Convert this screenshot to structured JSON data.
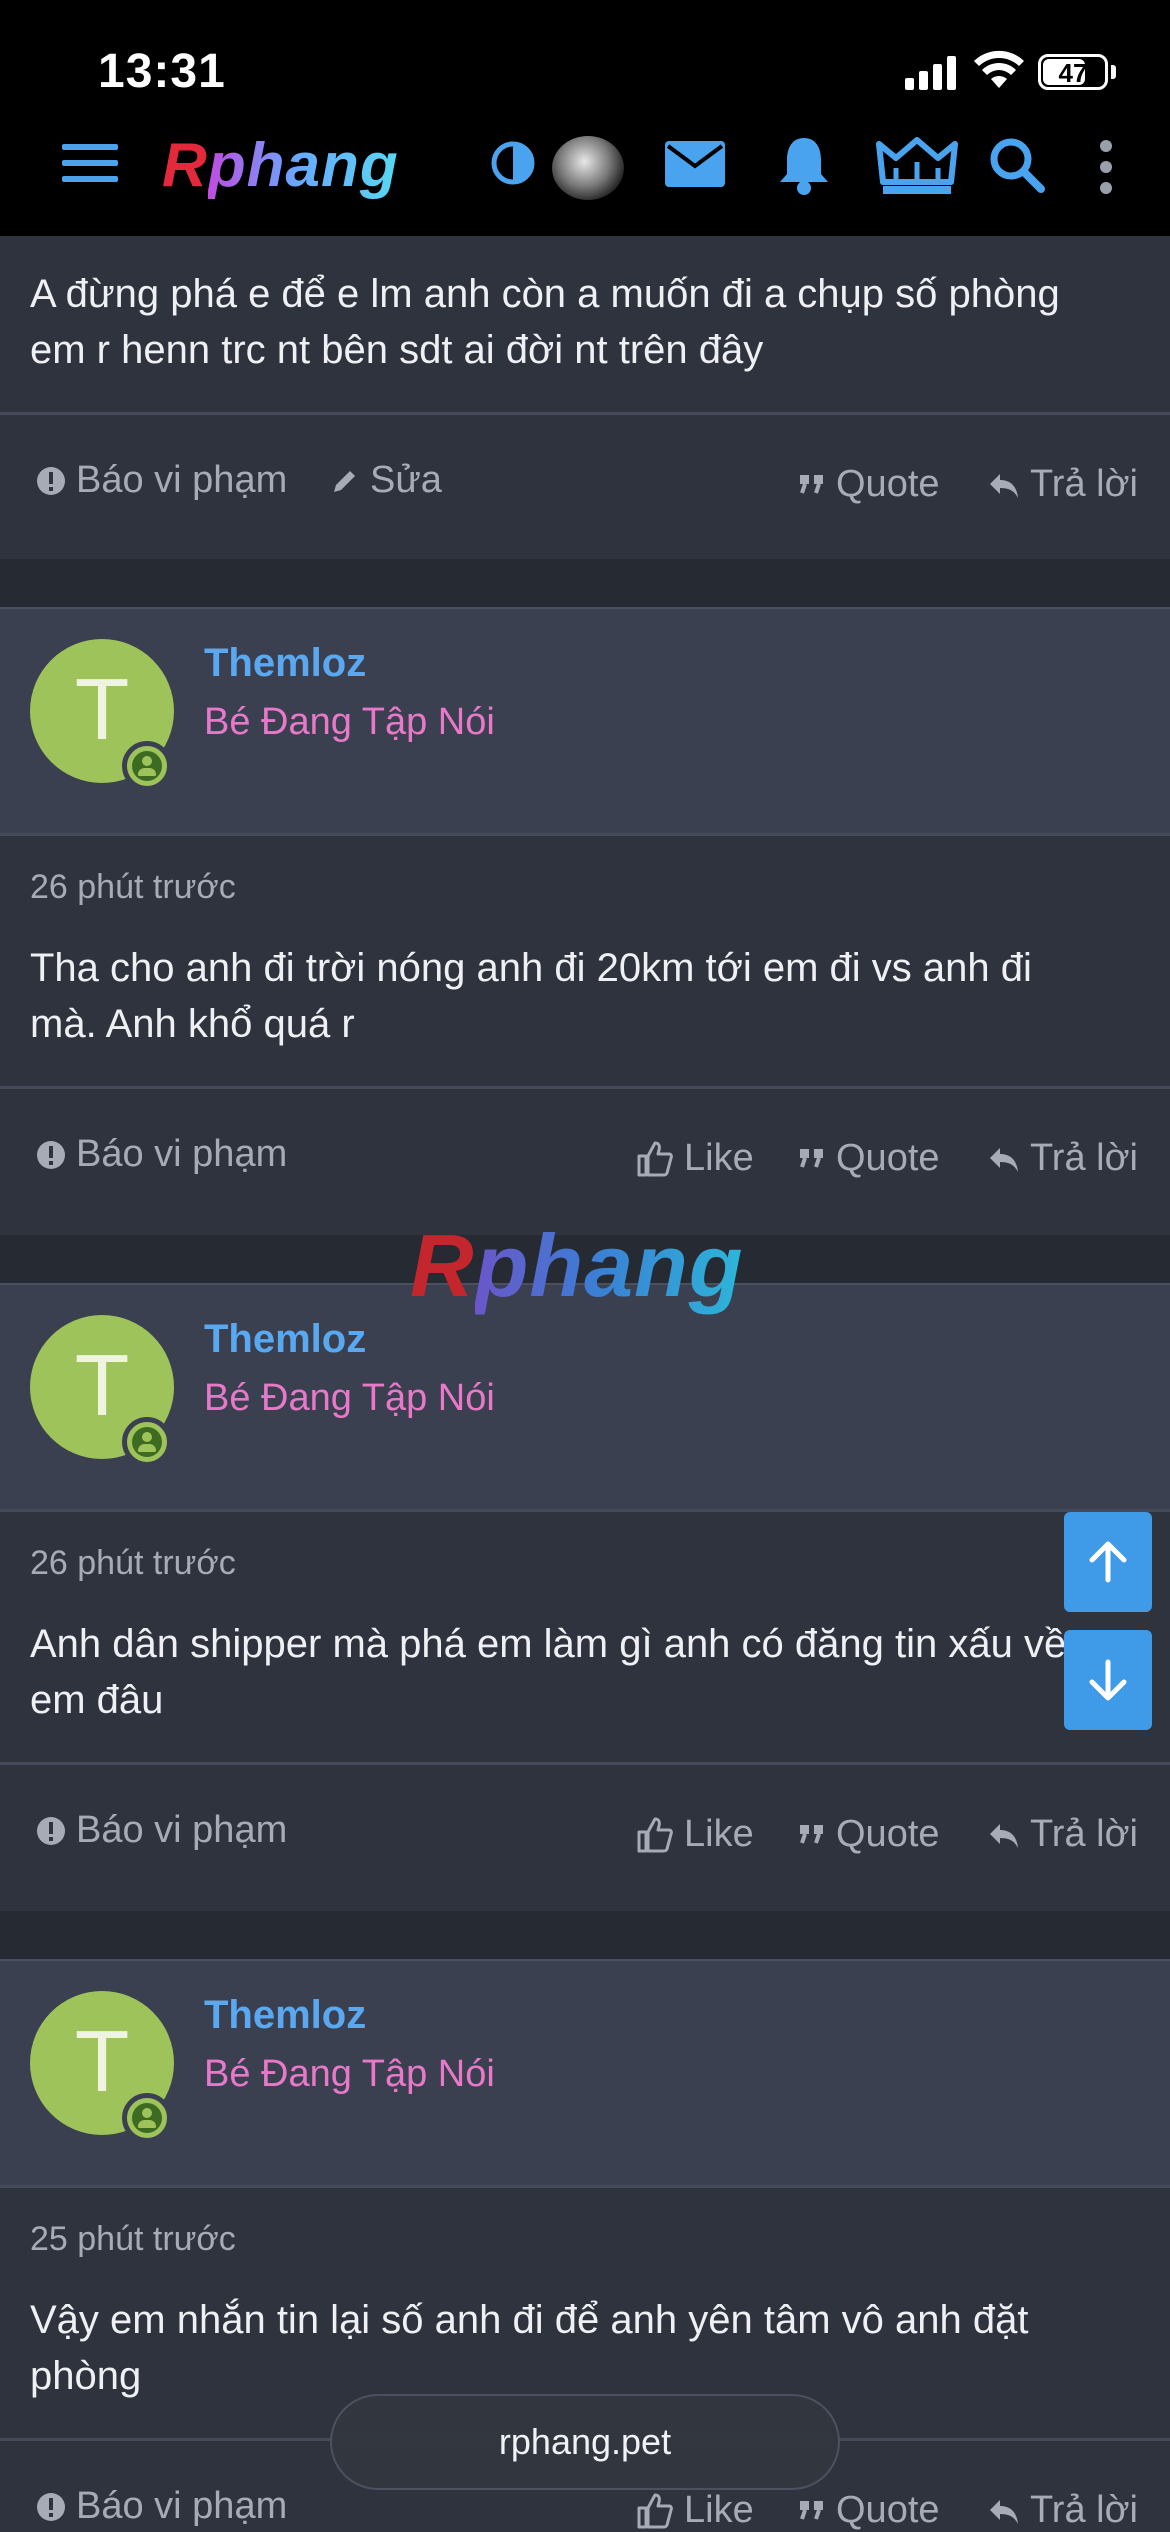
{
  "status_bar": {
    "time": "13:31",
    "battery": "47"
  },
  "site": {
    "logo_r": "R",
    "logo_rest": "phang"
  },
  "nav_icons": [
    "menu-icon",
    "theme-toggle-icon",
    "avatar",
    "mail-icon",
    "bell-icon",
    "crown-icon",
    "search-icon",
    "more-icon"
  ],
  "posts": [
    {
      "text": "A đừng phá e để e lm anh còn a muốn đi a chụp số phòng em r henn trc nt bên sdt ai đời nt trên đây",
      "actions": {
        "report": "Báo vi phạm",
        "edit": "Sửa",
        "quote": "Quote",
        "reply": "Trả lời"
      }
    },
    {
      "avatar_letter": "T",
      "username": "Themloz",
      "user_title": "Bé Đang Tập Nói",
      "time": "26 phút trước",
      "text": "Tha cho anh đi trời nóng anh đi 20km tới em đi vs anh đi mà. Anh khổ quá r",
      "actions": {
        "report": "Báo vi phạm",
        "like": "Like",
        "quote": "Quote",
        "reply": "Trả lời"
      }
    },
    {
      "avatar_letter": "T",
      "username": "Themloz",
      "user_title": "Bé Đang Tập Nói",
      "time": "26 phút trước",
      "text": "Anh dân shipper mà phá em làm gì anh có đăng tin xấu về em đâu",
      "actions": {
        "report": "Báo vi phạm",
        "like": "Like",
        "quote": "Quote",
        "reply": "Trả lời"
      }
    },
    {
      "avatar_letter": "T",
      "username": "Themloz",
      "user_title": "Bé Đang Tập Nói",
      "time": "25 phút trước",
      "text": "Vậy em nhắn tin lại số anh đi để anh yên tâm vô anh đặt phòng",
      "actions": {
        "report": "Báo vi phạm",
        "like": "Like",
        "quote": "Quote",
        "reply": "Trả lời"
      }
    }
  ],
  "watermark": {
    "r": "R",
    "rest": "phang"
  },
  "url": "rphang.pet",
  "colors": {
    "accent": "#3f9ae8",
    "username": "#5aa8f0",
    "user_title": "#e879c9",
    "avatar_bg": "#9dc35a"
  }
}
